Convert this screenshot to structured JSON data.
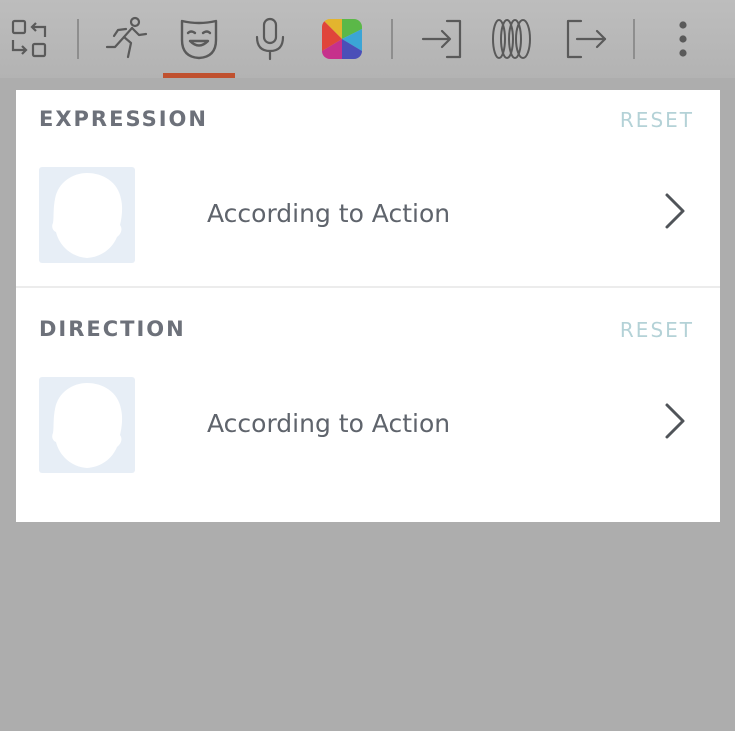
{
  "toolbar": {
    "icons": [
      {
        "name": "swap-icon"
      },
      {
        "name": "motion-icon"
      },
      {
        "name": "expression-mask-icon",
        "active": true
      },
      {
        "name": "microphone-icon"
      },
      {
        "name": "color-palette-icon"
      },
      {
        "name": "enter-icon"
      },
      {
        "name": "transition-rings-icon"
      },
      {
        "name": "exit-icon"
      },
      {
        "name": "more-vertical-icon"
      }
    ],
    "active_tab_color": "#c0512f",
    "palette_colors": [
      "#e3b42e",
      "#e0453a",
      "#c6318c",
      "#4b4fb8",
      "#3ba5d6",
      "#5bb848"
    ]
  },
  "sections": {
    "expression": {
      "title": "EXPRESSION",
      "reset_label": "RESET",
      "value": "According to Action"
    },
    "direction": {
      "title": "DIRECTION",
      "reset_label": "RESET",
      "value": "According to Action"
    }
  },
  "colors": {
    "reset_text": "#b4d2d7",
    "title_text": "#6d717a",
    "thumb_bg": "#e7eef6"
  }
}
